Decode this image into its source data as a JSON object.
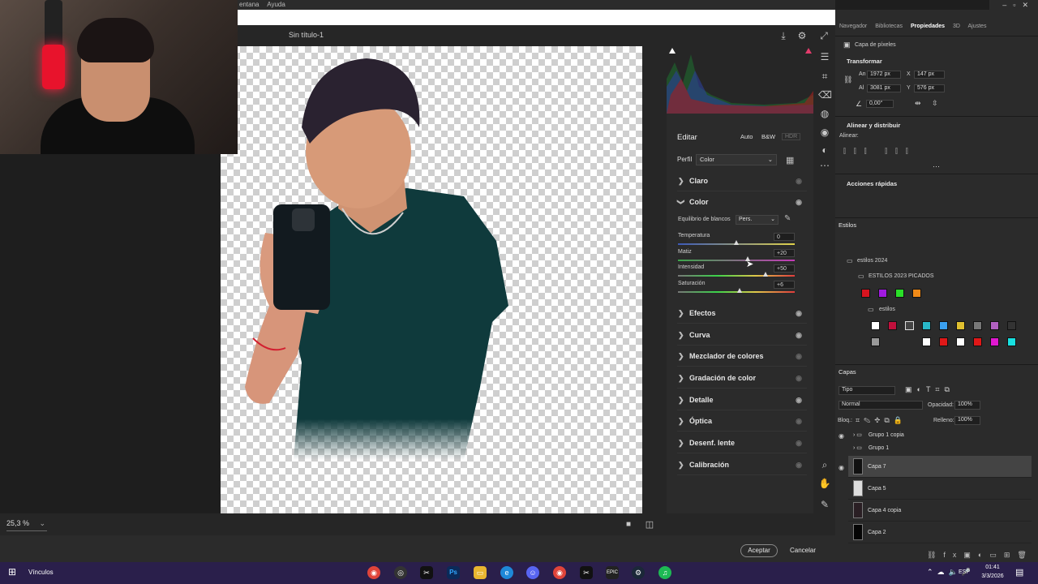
{
  "menu": {
    "items": [
      "entana",
      "Ayuda"
    ]
  },
  "document": {
    "title": "Sin título-1",
    "zoom": "25,3 %"
  },
  "camera_raw": {
    "edit_label": "Editar",
    "mode_buttons": [
      "Auto",
      "B&W",
      "HDR"
    ],
    "profile_label": "Perfil",
    "profile_value": "Color",
    "sections": [
      {
        "label": "Claro",
        "expanded": false
      },
      {
        "label": "Color",
        "expanded": true
      },
      {
        "label": "Efectos",
        "expanded": false
      },
      {
        "label": "Curva",
        "expanded": false
      },
      {
        "label": "Mezclador de colores",
        "expanded": false
      },
      {
        "label": "Gradación de color",
        "expanded": false
      },
      {
        "label": "Detalle",
        "expanded": false
      },
      {
        "label": "Óptica",
        "expanded": false
      },
      {
        "label": "Desenf. lente",
        "expanded": false
      },
      {
        "label": "Calibración",
        "expanded": false
      }
    ],
    "white_balance_label": "Equilibrio de blancos",
    "white_balance_value": "Pers.",
    "sliders": [
      {
        "label": "Temperatura",
        "value": "0",
        "pos": 0.5
      },
      {
        "label": "Matiz",
        "value": "+20",
        "pos": 0.6
      },
      {
        "label": "Intensidad",
        "value": "+50",
        "pos": 0.75
      },
      {
        "label": "Saturación",
        "value": "+6",
        "pos": 0.53
      }
    ],
    "accept_label": "Aceptar",
    "cancel_label": "Cancelar"
  },
  "panels": {
    "top_tabs": [
      "Navegador",
      "Bibliotecas",
      "Propiedades",
      "3D",
      "Ajustes"
    ],
    "active_tab": "Propiedades",
    "pixel_layer_label": "Capa de píxeles",
    "transform_label": "Transformar",
    "an_label": "An",
    "an_value": "1972 px",
    "x_label": "X",
    "x_value": "147 px",
    "al_label": "Al",
    "al_value": "3081 px",
    "y_label": "Y",
    "y_value": "576 px",
    "angle_value": "0,00°",
    "align_label": "Alinear y distribuir",
    "align_sub": "Alinear:",
    "quick_actions": "Acciones rápidas",
    "styles_tab": "Estilos",
    "styles_group1": "estilos 2024",
    "styles_group2": "ESTILOS 2023 PICADOS",
    "styles_group3": "estilos",
    "layers_tab": "Capas",
    "layers_filter": "Tipo",
    "blend_mode": "Normal",
    "opacity_label": "Opacidad:",
    "opacity_value": "100%",
    "lock_label": "Bloq.:",
    "fill_label": "Relleno:",
    "fill_value": "100%",
    "layers": [
      "Grupo 1 copia",
      "Grupo 1",
      "Capa 7",
      "Capa 5",
      "Capa 4 copia",
      "Capa 2"
    ]
  },
  "taskbar": {
    "label": "Vínculos",
    "lang": "ESP",
    "time": "01:41",
    "date": "3/3/2026"
  },
  "colors": {
    "accent": "#e8132c",
    "taskbar": "#2a1f4b",
    "panel": "#2b2b2b"
  }
}
